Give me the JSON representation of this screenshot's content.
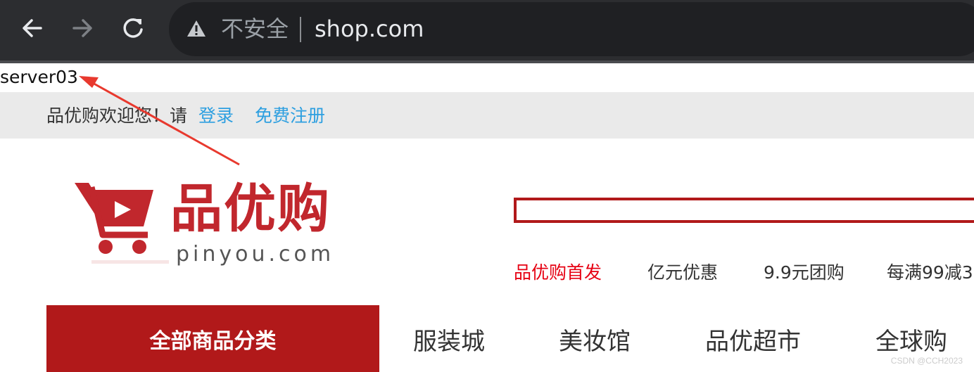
{
  "browser": {
    "security_label": "不安全",
    "url": "shop.com"
  },
  "page": {
    "server_name": "server03",
    "topbar": {
      "welcome": "品优购欢迎您！请",
      "login": "登录",
      "register": "免费注册"
    },
    "logo": {
      "brand": "品优购",
      "domain": "pinyou.com"
    },
    "hot_links": [
      "品优购首发",
      "亿元优惠",
      "9.9元团购",
      "每满99减3"
    ],
    "category_button": "全部商品分类",
    "nav": [
      "服装城",
      "美妆馆",
      "品优超市",
      "全球购"
    ],
    "watermark": "CSDN @CCH2023"
  },
  "colors": {
    "brand_red": "#b1191a",
    "link_blue": "#2d9fe0",
    "annotation_red": "#e8392e"
  }
}
